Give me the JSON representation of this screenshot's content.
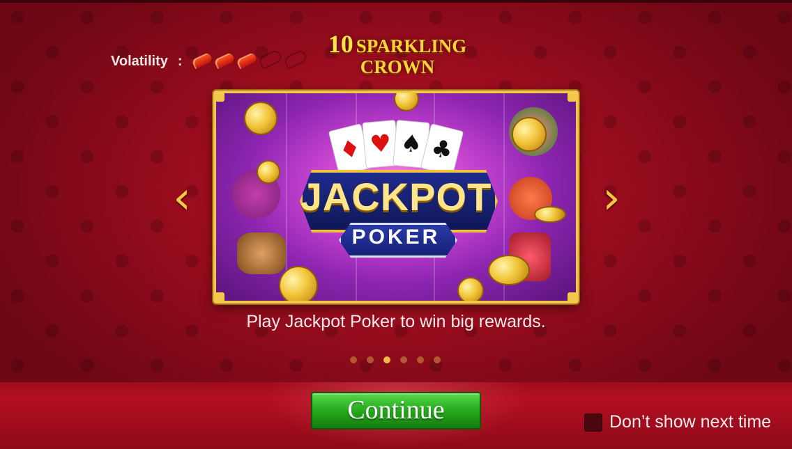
{
  "header": {
    "volatility_label": "Volatility",
    "volatility_separator": ":",
    "volatility_level": 3,
    "volatility_max": 5,
    "game_logo": {
      "number": "10",
      "line1": "SPARKLING",
      "line2": "CROWN"
    }
  },
  "carousel": {
    "current_index": 3,
    "total_slides": 6,
    "slide_title_line1": "JACKPOT",
    "slide_title_line2": "POKER",
    "caption": "Play Jackpot Poker to win big rewards.",
    "prev_icon": "chevron-left-icon",
    "next_icon": "chevron-right-icon",
    "cards": [
      "♦",
      "♥",
      "♠",
      "♣"
    ]
  },
  "footer": {
    "continue_label": "Continue",
    "dont_show_label": "Don’t show next time",
    "dont_show_checked": false
  },
  "colors": {
    "background": "#a50f20",
    "accent_gold": "#f4c84a",
    "button_green": "#2fae23"
  }
}
